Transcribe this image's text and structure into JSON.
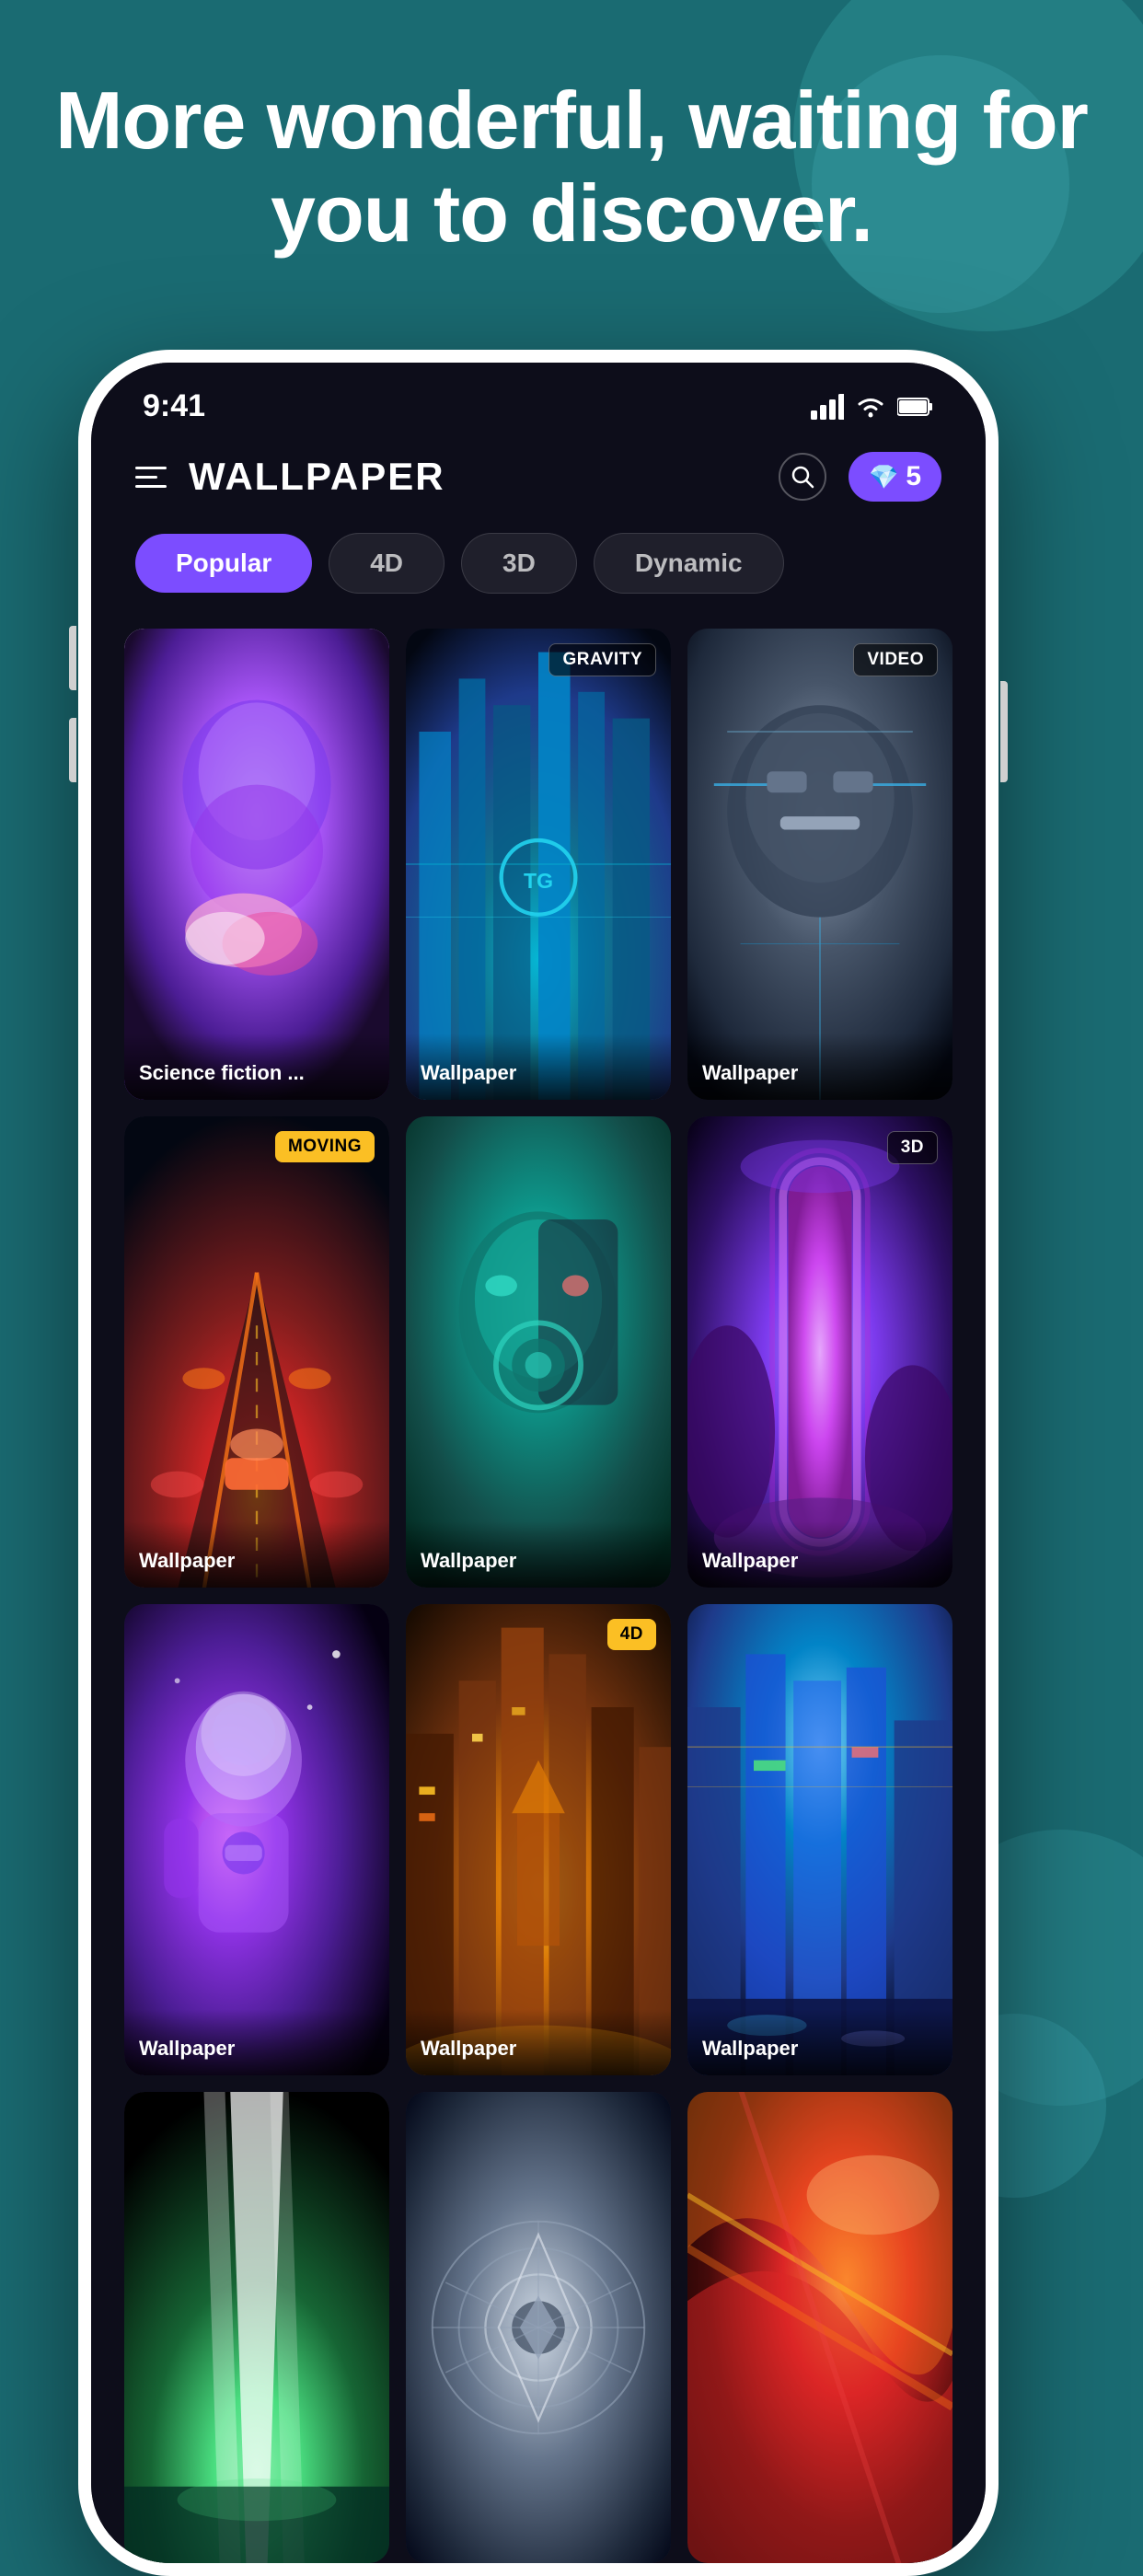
{
  "background": {
    "color": "#1a6b72"
  },
  "hero": {
    "title": "More wonderful, waiting for you to discover."
  },
  "statusBar": {
    "time": "9:41",
    "signal": "▲▲▲",
    "wifi": "wifi",
    "battery": "battery"
  },
  "appHeader": {
    "title": "WALLPAPER",
    "gemCount": "5",
    "searchAriaLabel": "Search"
  },
  "categories": {
    "tabs": [
      {
        "label": "Popular",
        "active": true
      },
      {
        "label": "4D",
        "active": false
      },
      {
        "label": "3D",
        "active": false
      },
      {
        "label": "Dynamic",
        "active": false
      }
    ]
  },
  "wallpaperGrid": {
    "items": [
      {
        "label": "Science fiction ...",
        "badge": null,
        "badgeType": null,
        "bgClass": "card-overlay-robot"
      },
      {
        "label": "Wallpaper",
        "badge": "GRAVITY",
        "badgeType": "gravity",
        "bgClass": "card-bg-2"
      },
      {
        "label": "Wallpaper",
        "badge": "VIDEO",
        "badgeType": "video",
        "bgClass": "card-bg-3"
      },
      {
        "label": "Wallpaper",
        "badge": "MOVING",
        "badgeType": "moving",
        "bgClass": "card-bg-4"
      },
      {
        "label": "Wallpaper",
        "badge": null,
        "badgeType": null,
        "bgClass": "card-bg-5"
      },
      {
        "label": "Wallpaper",
        "badge": "3D",
        "badgeType": "3d",
        "bgClass": "card-bg-6"
      },
      {
        "label": "Wallpaper",
        "badge": null,
        "badgeType": null,
        "bgClass": "card-bg-7"
      },
      {
        "label": "Wallpaper",
        "badge": "4D",
        "badgeType": "4d",
        "bgClass": "card-bg-8"
      },
      {
        "label": "Wallpaper",
        "badge": null,
        "badgeType": null,
        "bgClass": "card-bg-9"
      },
      {
        "label": "",
        "badge": null,
        "badgeType": null,
        "bgClass": "card-bg-10"
      },
      {
        "label": "",
        "badge": null,
        "badgeType": null,
        "bgClass": "card-bg-11"
      },
      {
        "label": "",
        "badge": null,
        "badgeType": null,
        "bgClass": "card-bg-12"
      }
    ]
  }
}
